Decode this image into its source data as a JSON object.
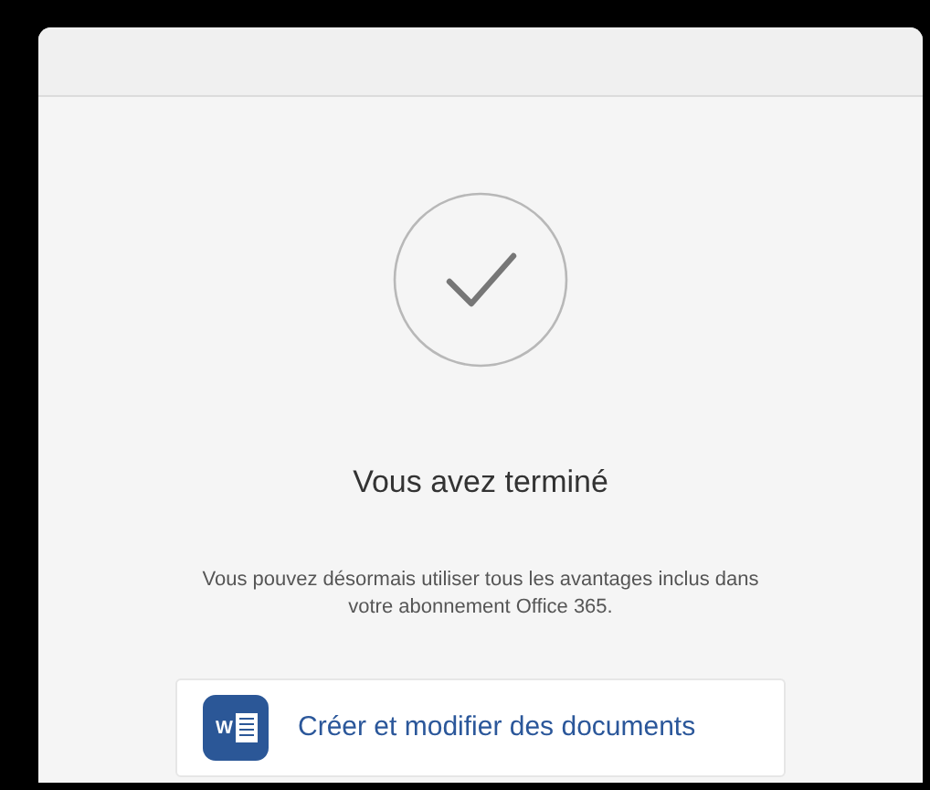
{
  "title": "Vous avez terminé",
  "message": "Vous pouvez désormais utiliser tous les avantages inclus dans votre abonnement Office 365.",
  "action": {
    "icon_letter": "W",
    "label": "Créer et modifier des documents"
  }
}
